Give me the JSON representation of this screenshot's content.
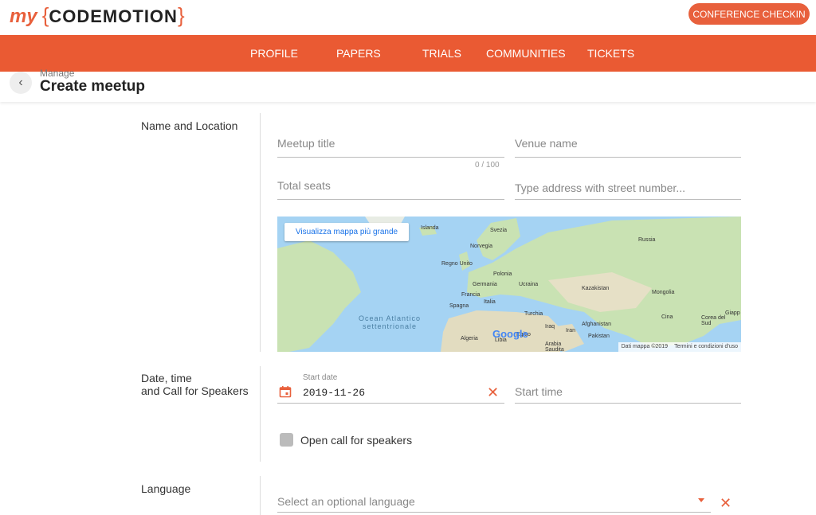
{
  "brand": {
    "my": "my",
    "open_brace": "{",
    "name": "CODEMOTION",
    "close_brace": "}"
  },
  "topbar": {
    "checkin_label": "CONFERENCE CHECKIN"
  },
  "nav": {
    "items": [
      "PROFILE",
      "PAPERS",
      "TRIALS",
      "COMMUNITIES",
      "TICKETS"
    ]
  },
  "header": {
    "breadcrumb": "Manage",
    "title": "Create meetup"
  },
  "sections": {
    "name_location": {
      "label": "Name and Location",
      "meetup_title_placeholder": "Meetup title",
      "title_counter": "0 / 100",
      "venue_placeholder": "Venue name",
      "seats_placeholder": "Total seats",
      "address_placeholder": "Type address with street number..."
    },
    "map": {
      "enlarge_label": "Visualizza mappa più grande",
      "ocean_line1": "Ocean Atlantico",
      "ocean_line2": "settentrionale",
      "labels": [
        "Islanda",
        "Svezia",
        "Russia",
        "Norvegia",
        "Regno Unito",
        "Polonia",
        "Germania",
        "Ucraina",
        "Kazakistan",
        "Francia",
        "Italia",
        "Mongolia",
        "Spagna",
        "Turchia",
        "Cina",
        "Afghanistan",
        "Iraq",
        "Iran",
        "Corea del Sud",
        "Giapp",
        "Algeria",
        "Libia",
        "Egitto",
        "Pakistan",
        "Arabia Saudita"
      ],
      "google": "Google",
      "attrib_data": "Dati mappa ©2019",
      "attrib_terms": "Termini e condizioni d'uso"
    },
    "date_time": {
      "label_line1": "Date, time",
      "label_line2": "and Call for Speakers",
      "start_date_label": "Start date",
      "start_date_value": "2019-11-26",
      "start_time_placeholder": "Start time",
      "call_label": "Open call for speakers"
    },
    "language": {
      "label": "Language",
      "select_placeholder": "Select an optional language"
    }
  },
  "colors": {
    "accent": "#ea5a33",
    "map_water": "#a5d3f3",
    "map_land": "#c9e2b3"
  },
  "icons": {
    "back": "chevron-left-icon",
    "calendar": "calendar-icon",
    "clear": "close-icon",
    "dropdown": "caret-down-icon"
  }
}
